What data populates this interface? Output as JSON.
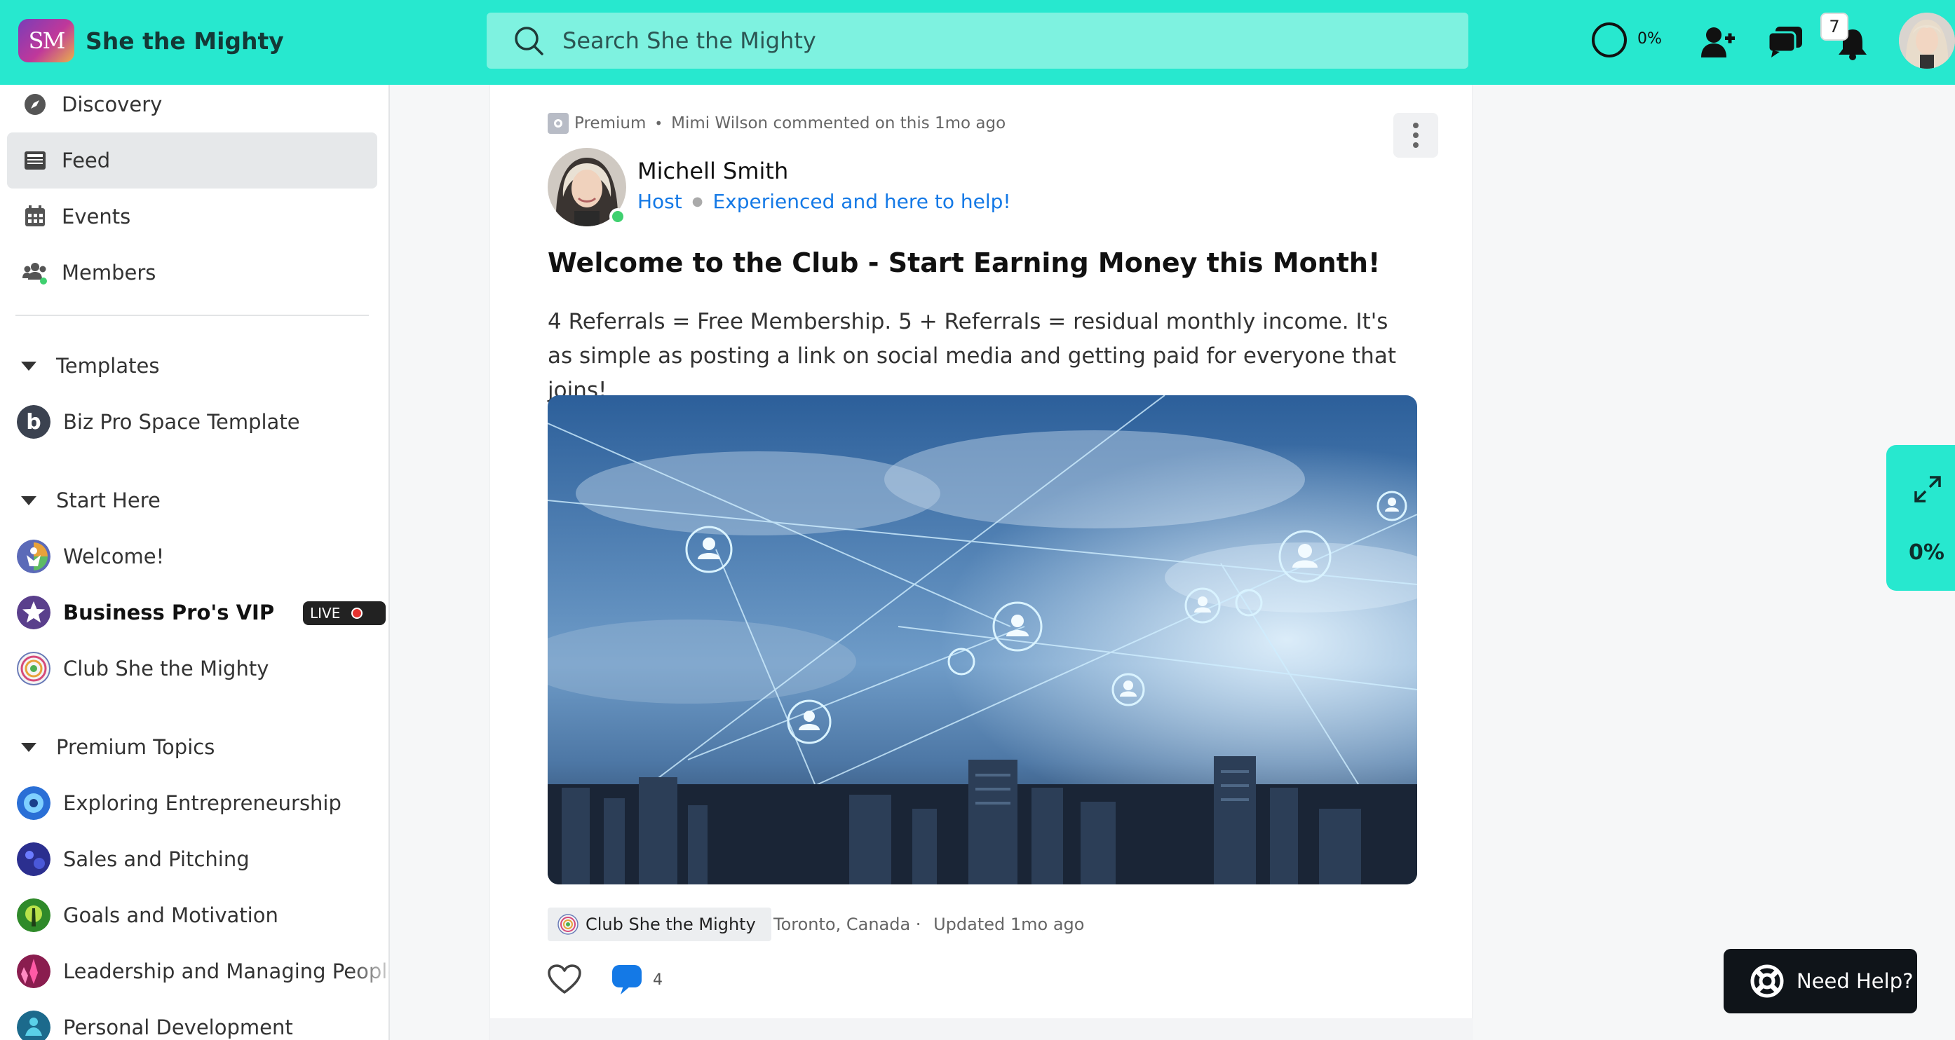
{
  "app": {
    "brand_initials": "SM",
    "brand_name": "She the Mighty",
    "accent_color": "#27e8cf"
  },
  "header": {
    "search_placeholder": "Search She the Mighty",
    "progress_text": "0%",
    "notification_count": "7",
    "icons": [
      "search-icon",
      "progress-ring-icon",
      "add-member-icon",
      "messages-icon",
      "bell-icon",
      "avatar"
    ]
  },
  "sidebar": {
    "nav": [
      {
        "label": "Discovery",
        "icon": "compass-icon"
      },
      {
        "label": "Feed",
        "icon": "feed-icon",
        "active": true
      },
      {
        "label": "Events",
        "icon": "calendar-icon"
      },
      {
        "label": "Members",
        "icon": "members-icon"
      }
    ],
    "sections": [
      {
        "label": "Templates",
        "items": [
          {
            "label": "Biz Pro Space Template"
          }
        ]
      },
      {
        "label": "Start Here",
        "items": [
          {
            "label": "Welcome!"
          },
          {
            "label": "Business Pro's VIP",
            "live": "LIVE"
          },
          {
            "label": "Club She the Mighty"
          }
        ]
      },
      {
        "label": "Premium Topics",
        "items": [
          {
            "label": "Exploring Entrepreneurship"
          },
          {
            "label": "Sales and Pitching"
          },
          {
            "label": "Goals and Motivation"
          },
          {
            "label": "Leadership and Managing People"
          },
          {
            "label": "Personal Development"
          }
        ]
      }
    ]
  },
  "post": {
    "tag": "Premium",
    "activity": "Mimi Wilson commented on this 1mo ago",
    "author": "Michell Smith",
    "author_role": "Host",
    "author_tagline": "Experienced and here to help!",
    "title": "Welcome to the Club - Start Earning Money this Month!",
    "body": "4 Referrals = Free Membership. 5 + Referrals = residual monthly income. It's as simple as posting a link on social media and getting paid for everyone that joins!",
    "space": "Club She the Mighty",
    "location": "Toronto, Canada ·",
    "updated": "Updated 1mo ago",
    "comment_count": "4"
  },
  "float_panel": {
    "progress_text": "0%"
  },
  "help": {
    "label": "Need Help?"
  }
}
